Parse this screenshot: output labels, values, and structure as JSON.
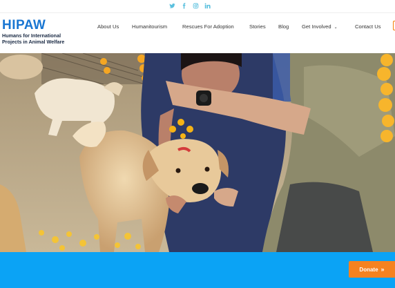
{
  "social": {
    "icons": [
      "twitter-icon",
      "facebook-icon",
      "instagram-icon",
      "linkedin-icon"
    ],
    "color": "#5bc0de"
  },
  "logo": {
    "title": "HIPAW",
    "subtitle_line1": "Humans for International",
    "subtitle_line2": "Projects in Animal Welfare"
  },
  "nav": {
    "items": [
      {
        "label": "About Us"
      },
      {
        "label": "Humanitourism"
      },
      {
        "label": "Rescues For Adoption"
      },
      {
        "label": "Stories"
      },
      {
        "label": "Blog"
      },
      {
        "label": "Get Involved",
        "dropdown": true
      },
      {
        "label": "Contact Us"
      }
    ]
  },
  "hero": {
    "scene": "Volunteers placing marigold garland and tika on a rescued street dog"
  },
  "cta": {
    "donate_label": "Donate",
    "donate_icon": "double-chevron-right-icon",
    "bar_color": "#0ba3f5",
    "button_color": "#f58220"
  }
}
